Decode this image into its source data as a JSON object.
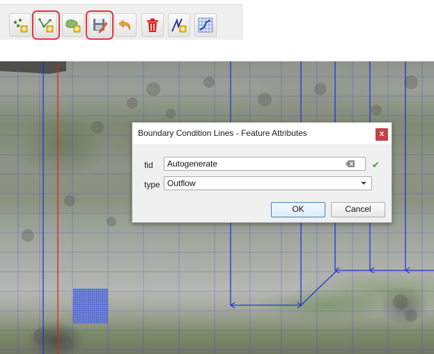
{
  "toolbar": {
    "buttons": [
      {
        "icon": "add-point-feature-icon",
        "highlighted": false
      },
      {
        "icon": "add-line-feature-icon",
        "highlighted": true
      },
      {
        "icon": "add-polygon-feature-icon",
        "highlighted": false
      },
      {
        "icon": "save-edits-icon",
        "highlighted": true
      },
      {
        "icon": "undo-icon",
        "highlighted": false
      },
      {
        "icon": "delete-icon",
        "highlighted": false
      },
      {
        "icon": "boundary-line-tool-icon",
        "highlighted": false
      },
      {
        "icon": "grid-schematize-icon",
        "highlighted": false
      }
    ]
  },
  "dialog": {
    "title": "Boundary Condition Lines - Feature Attributes",
    "close_label": "x",
    "fields": {
      "fid": {
        "label": "fid",
        "value": "Autogenerate"
      },
      "type": {
        "label": "type",
        "value": "Outflow"
      }
    },
    "ok_label": "OK",
    "cancel_label": "Cancel"
  },
  "colors": {
    "accent_highlight": "#e0303a",
    "grid_line": "#2b3fd6",
    "boundary_line": "#e02020",
    "close_button": "#c7434a",
    "valid_check": "#3b9a2a"
  }
}
